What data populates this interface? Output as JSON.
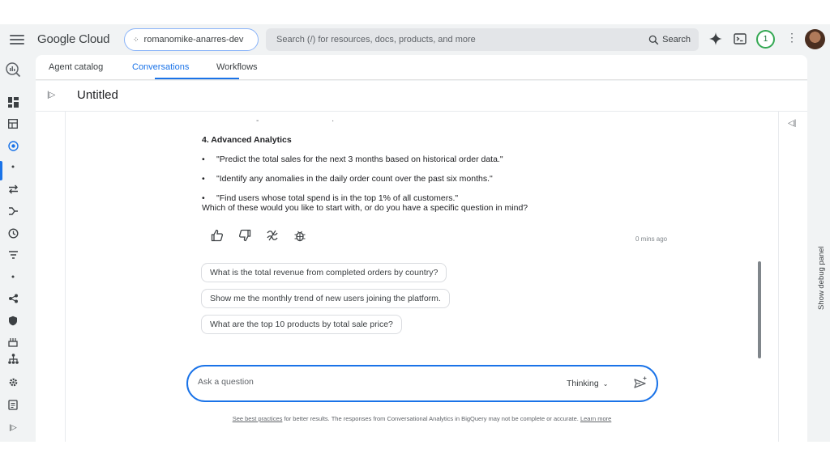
{
  "header": {
    "logo": "Google Cloud",
    "project": "romanomike-anarres-dev",
    "search_placeholder": "Search (/) for resources, docs, products, and more",
    "search_button": "Search",
    "notifications_count": "1"
  },
  "tabs": [
    {
      "label": "Agent catalog",
      "active": false
    },
    {
      "label": "Conversations",
      "active": true
    },
    {
      "label": "Workflows",
      "active": false
    }
  ],
  "page": {
    "title": "Untitled"
  },
  "response": {
    "section_heading": "4. Advanced Analytics",
    "bullets": [
      "\"Predict the total sales for the next 3 months based on historical order data.\"",
      "\"Identify any anomalies in the daily order count over the past six months.\"",
      "\"Find users whose total spend is in the top 1% of all customers.\""
    ],
    "closing": "Which of these would you like to start with, or do you have a specific question in mind?",
    "timestamp": "0 mins ago"
  },
  "suggestions": [
    "What is the total revenue from completed orders by country?",
    "Show me the monthly trend of new users joining the platform.",
    "What are the top 10 products by total sale price?"
  ],
  "composer": {
    "placeholder": "Ask a question",
    "mode": "Thinking"
  },
  "disclaimer": {
    "link1": "See best practices",
    "middle": " for better results. The responses from Conversational Analytics in BigQuery may not be complete or accurate. ",
    "link2": "Learn more"
  },
  "debug_panel_label": "Show debug panel",
  "colors": {
    "accent": "#1a73e8",
    "notification_ring": "#34a853"
  }
}
